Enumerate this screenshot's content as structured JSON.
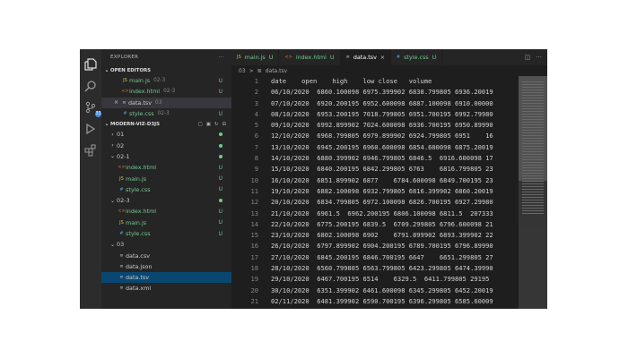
{
  "explorer": {
    "title": "EXPLORER",
    "more": "···",
    "open_editors_title": "OPEN EDITORS",
    "open_editors": [
      {
        "name": "main.js",
        "desc": "02-3",
        "status": "U",
        "icon": "js",
        "active": false
      },
      {
        "name": "index.html",
        "desc": "02-3",
        "status": "U",
        "icon": "html",
        "active": false
      },
      {
        "name": "data.tsv",
        "desc": "03",
        "status": "",
        "icon": "data",
        "active": true
      },
      {
        "name": "style.css",
        "desc": "02-3",
        "status": "U",
        "icon": "css",
        "active": false
      }
    ],
    "project_title": "MODERN-VIZ-D3JS",
    "tree": [
      {
        "name": "01",
        "kind": "folder",
        "indent": 1,
        "open": false,
        "status": "dot"
      },
      {
        "name": "02",
        "kind": "folder",
        "indent": 1,
        "open": false,
        "status": "dot"
      },
      {
        "name": "02-1",
        "kind": "folder",
        "indent": 1,
        "open": true,
        "status": "dot"
      },
      {
        "name": "index.html",
        "kind": "file",
        "icon": "html",
        "indent": 2,
        "status": "U"
      },
      {
        "name": "main.js",
        "kind": "file",
        "icon": "js",
        "indent": 2,
        "status": "U"
      },
      {
        "name": "style.css",
        "kind": "file",
        "icon": "css",
        "indent": 2,
        "status": "U"
      },
      {
        "name": "02-3",
        "kind": "folder",
        "indent": 1,
        "open": true,
        "status": "dot"
      },
      {
        "name": "index.html",
        "kind": "file",
        "icon": "html",
        "indent": 2,
        "status": "U"
      },
      {
        "name": "main.js",
        "kind": "file",
        "icon": "js",
        "indent": 2,
        "status": "U"
      },
      {
        "name": "style.css",
        "kind": "file",
        "icon": "css",
        "indent": 2,
        "status": "U"
      },
      {
        "name": "03",
        "kind": "folder",
        "indent": 1,
        "open": true,
        "status": ""
      },
      {
        "name": "data.csv",
        "kind": "file",
        "icon": "data",
        "indent": 2,
        "status": ""
      },
      {
        "name": "data.json",
        "kind": "file",
        "icon": "data",
        "indent": 2,
        "status": ""
      },
      {
        "name": "data.tsv",
        "kind": "file",
        "icon": "data",
        "indent": 2,
        "status": "",
        "selected": true
      },
      {
        "name": "data.xml",
        "kind": "file",
        "icon": "data",
        "indent": 2,
        "status": ""
      }
    ]
  },
  "activity_badge": "33",
  "tabs": [
    {
      "name": "main.js",
      "status": "U",
      "icon": "js",
      "active": false
    },
    {
      "name": "index.html",
      "status": "U",
      "icon": "html",
      "active": false
    },
    {
      "name": "data.tsv",
      "status": "",
      "icon": "data",
      "active": true
    },
    {
      "name": "style.css",
      "status": "U",
      "icon": "css",
      "active": false
    }
  ],
  "breadcrumb": {
    "folder": "03",
    "sep": ">",
    "file": "data.tsv"
  },
  "editor": {
    "lines": [
      "date    open    high    low close   volume",
      "06/10/2020  6860.100098 6975.399902 6838.799805 6936.20019",
      "07/10/2020  6920.200195 6952.600098 6887.100098 6910.00000",
      "08/10/2020  6953.200195 7018.799805 6951.700195 6992.79980",
      "09/10/2020  6992.899902 7024.600098 6936.700195 6950.89990",
      "12/10/2020  6968.799805 6979.899902 6924.799805 6951    16",
      "13/10/2020  6945.200195 6960.600098 6854.600098 6875.20019",
      "14/10/2020  6880.399902 6946.799805 6846.5  6916.600098 17",
      "15/10/2020  6840.200195 6842.299805 6763    6816.799805 23",
      "16/10/2020  6851.899902 6877    6784.600098 6849.700195 23",
      "19/10/2020  6882.100098 6932.799805 6816.399902 6860.20019",
      "20/10/2020  6834.799805 6972.100098 6826.700195 6927.29980",
      "21/10/2020  6961.5  6962.200195 6806.100098 6811.5  207333",
      "22/10/2020  6775.200195 6839.5  6709.299805 6796.600098 21",
      "23/10/2020  6802.100098 6902    6791.899902 6893.399902 22",
      "26/10/2020  6797.899902 6904.200195 6789.700195 6796.89990",
      "27/10/2020  6845.200195 6846.700195 6647    6651.299805 27",
      "28/10/2020  6560.799805 6563.799805 6423.299805 6474.39990",
      "29/10/2020  6467.700195 6514    6329.5  6411.799805 29195",
      "30/10/2020  6351.399902 6461.600098 6345.299805 6452.20019",
      "02/11/2020  6481.399902 6590.700195 6396.299805 6585.60009"
    ]
  }
}
